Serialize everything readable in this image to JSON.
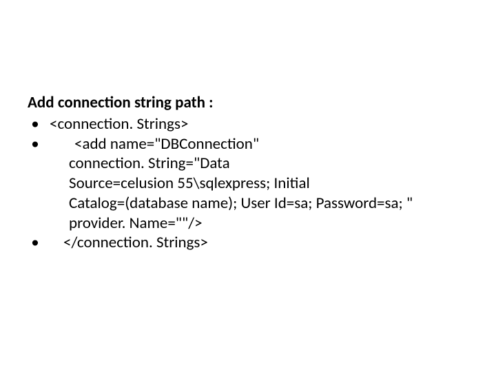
{
  "title": "Add connection string path :",
  "bullets": {
    "b1": "<connection. Strings>",
    "b2": "<add name=\"DBConnection\" connection. String=\"Data Source=celusion 55\\sqlexpress; Initial Catalog=(database name); User Id=sa; Password=sa; \" provider. Name=\"\"/>",
    "b2_line1": "<add name=\"DBConnection\"",
    "b2_line2": "connection. String=\"Data",
    "b2_line3": "Source=celusion 55\\sqlexpress; Initial",
    "b2_line4": "Catalog=(database name); User Id=sa; Password=sa; \"",
    "b2_line5": "provider. Name=\"\"/>",
    "b3": "</connection. Strings>"
  },
  "bullet_char": "•"
}
